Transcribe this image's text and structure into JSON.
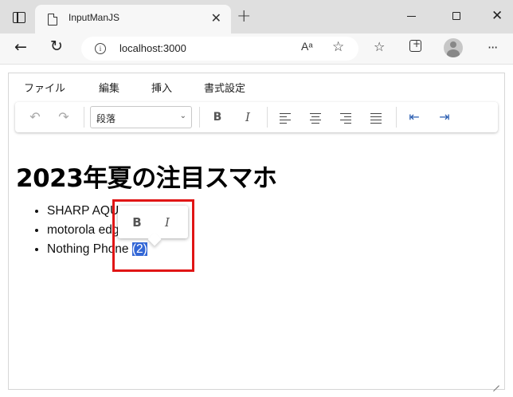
{
  "browser": {
    "tab_title": "InputManJS",
    "tab_close": "✕",
    "new_tab": "+",
    "url": "localhost:3000",
    "read_aloud": "Aᵃ",
    "back_glyph": "←",
    "refresh_glyph": "↻",
    "favorite_glyph": "☆",
    "favorites_bar_glyph": "☆",
    "more_glyph": "···",
    "info_glyph": "i",
    "close_glyph": "✕"
  },
  "editor": {
    "menu": [
      "ファイル",
      "編集",
      "挿入",
      "書式設定"
    ],
    "toolbar": {
      "undo": "↶",
      "redo": "↷",
      "block_format": "段落",
      "block_chevron": "⌄",
      "bold": "B",
      "italic": "I",
      "outdent": "⇤",
      "indent": "⇥"
    },
    "title": "2023年夏の注目スマホ",
    "items": [
      {
        "before": "SHARP AQU",
        "selected": "",
        "after": ""
      },
      {
        "before": "motorola edge 4",
        "selected": "",
        "after": ""
      },
      {
        "before": "Nothing Phone ",
        "selected": "(2)",
        "after": ""
      }
    ],
    "quickbar": {
      "bold": "B",
      "italic": "I"
    }
  },
  "colors": {
    "selection": "#3367d6",
    "annotation_border": "#e01515"
  }
}
